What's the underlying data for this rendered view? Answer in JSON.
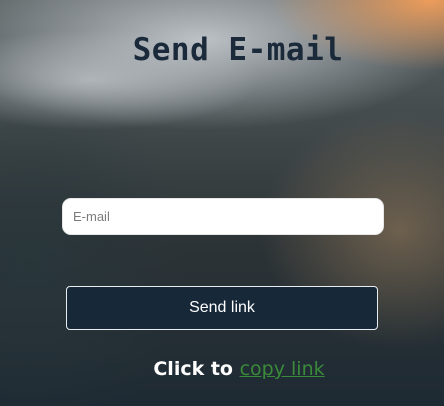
{
  "page": {
    "title": "Send E-mail"
  },
  "form": {
    "email_placeholder": "E-mail",
    "send_button_label": "Send link"
  },
  "footer": {
    "click_text": "Click to ",
    "copy_link_label": "copy link"
  },
  "colors": {
    "title": "#1b2a3a",
    "button_background": "#172838",
    "link": "#3a8a3a"
  }
}
